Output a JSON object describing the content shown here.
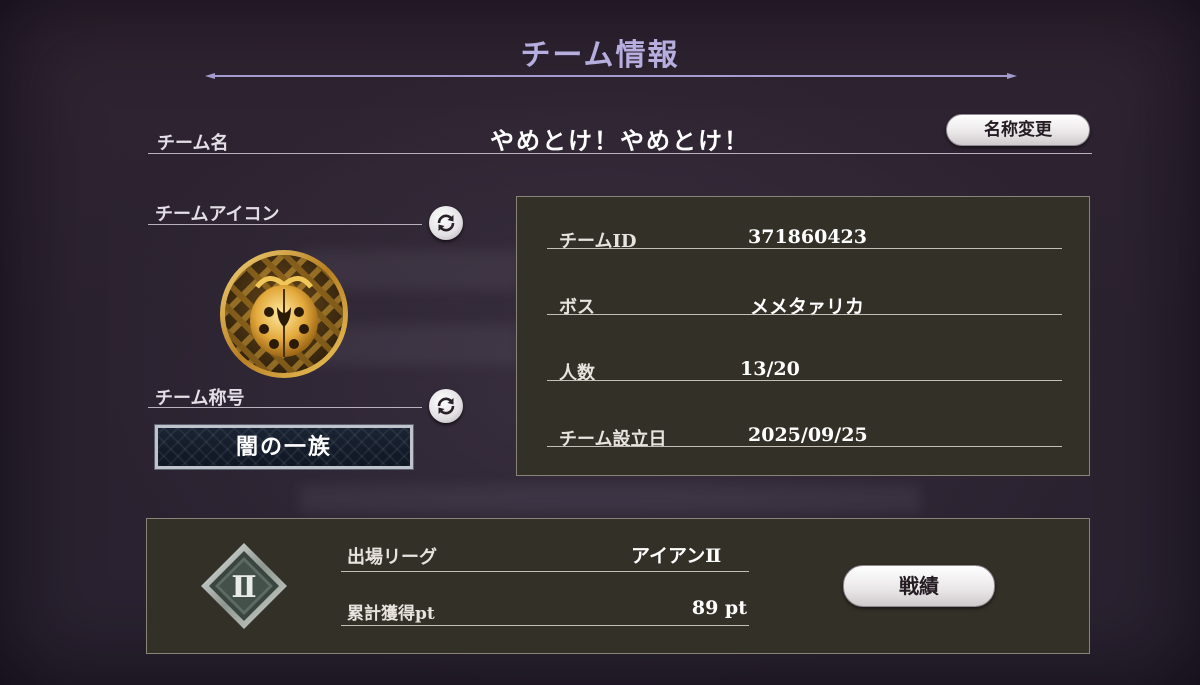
{
  "header": {
    "title": "チーム情報"
  },
  "team_name": {
    "label": "チーム名",
    "value": "やめとけ！やめとけ！",
    "rename_button": "名称変更"
  },
  "team_icon": {
    "label": "チームアイコン"
  },
  "team_title": {
    "label": "チーム称号",
    "value": "闇の一族"
  },
  "info": {
    "team_id_label": "チームID",
    "team_id_value": "371860423",
    "boss_label": "ボス",
    "boss_value": "メメタァリカ",
    "members_label": "人数",
    "members_value": "13/20",
    "founded_label": "チーム設立日",
    "founded_value": "2025/09/25"
  },
  "league": {
    "rank_badge": "Ⅱ",
    "league_label": "出場リーグ",
    "league_value": "アイアンⅡ",
    "points_label": "累計獲得pt",
    "points_value": "89 pt",
    "record_button": "戦績"
  },
  "colors": {
    "background": "#2c2330",
    "title_accent": "#b7aee0",
    "panel": "#333027",
    "panel_border": "#8a8478",
    "emblem_gold": "#d9a53a"
  },
  "icons": {
    "refresh_icon": "circular-arrows",
    "team_emblem": "gold-ladybug-emblem",
    "rank_badge_icon": "diamond-rank-frame"
  }
}
